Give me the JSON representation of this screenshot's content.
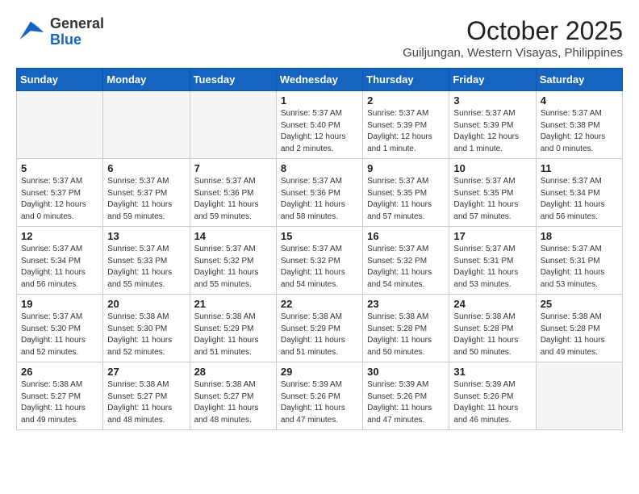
{
  "logo": {
    "general": "General",
    "blue": "Blue"
  },
  "header": {
    "month": "October 2025",
    "location": "Guiljungan, Western Visayas, Philippines"
  },
  "weekdays": [
    "Sunday",
    "Monday",
    "Tuesday",
    "Wednesday",
    "Thursday",
    "Friday",
    "Saturday"
  ],
  "weeks": [
    [
      {
        "day": "",
        "empty": true
      },
      {
        "day": "",
        "empty": true
      },
      {
        "day": "",
        "empty": true
      },
      {
        "day": "1",
        "sunrise": "Sunrise: 5:37 AM",
        "sunset": "Sunset: 5:40 PM",
        "daylight": "Daylight: 12 hours and 2 minutes."
      },
      {
        "day": "2",
        "sunrise": "Sunrise: 5:37 AM",
        "sunset": "Sunset: 5:39 PM",
        "daylight": "Daylight: 12 hours and 1 minute."
      },
      {
        "day": "3",
        "sunrise": "Sunrise: 5:37 AM",
        "sunset": "Sunset: 5:39 PM",
        "daylight": "Daylight: 12 hours and 1 minute."
      },
      {
        "day": "4",
        "sunrise": "Sunrise: 5:37 AM",
        "sunset": "Sunset: 5:38 PM",
        "daylight": "Daylight: 12 hours and 0 minutes."
      }
    ],
    [
      {
        "day": "5",
        "sunrise": "Sunrise: 5:37 AM",
        "sunset": "Sunset: 5:37 PM",
        "daylight": "Daylight: 12 hours and 0 minutes."
      },
      {
        "day": "6",
        "sunrise": "Sunrise: 5:37 AM",
        "sunset": "Sunset: 5:37 PM",
        "daylight": "Daylight: 11 hours and 59 minutes."
      },
      {
        "day": "7",
        "sunrise": "Sunrise: 5:37 AM",
        "sunset": "Sunset: 5:36 PM",
        "daylight": "Daylight: 11 hours and 59 minutes."
      },
      {
        "day": "8",
        "sunrise": "Sunrise: 5:37 AM",
        "sunset": "Sunset: 5:36 PM",
        "daylight": "Daylight: 11 hours and 58 minutes."
      },
      {
        "day": "9",
        "sunrise": "Sunrise: 5:37 AM",
        "sunset": "Sunset: 5:35 PM",
        "daylight": "Daylight: 11 hours and 57 minutes."
      },
      {
        "day": "10",
        "sunrise": "Sunrise: 5:37 AM",
        "sunset": "Sunset: 5:35 PM",
        "daylight": "Daylight: 11 hours and 57 minutes."
      },
      {
        "day": "11",
        "sunrise": "Sunrise: 5:37 AM",
        "sunset": "Sunset: 5:34 PM",
        "daylight": "Daylight: 11 hours and 56 minutes."
      }
    ],
    [
      {
        "day": "12",
        "sunrise": "Sunrise: 5:37 AM",
        "sunset": "Sunset: 5:34 PM",
        "daylight": "Daylight: 11 hours and 56 minutes."
      },
      {
        "day": "13",
        "sunrise": "Sunrise: 5:37 AM",
        "sunset": "Sunset: 5:33 PM",
        "daylight": "Daylight: 11 hours and 55 minutes."
      },
      {
        "day": "14",
        "sunrise": "Sunrise: 5:37 AM",
        "sunset": "Sunset: 5:32 PM",
        "daylight": "Daylight: 11 hours and 55 minutes."
      },
      {
        "day": "15",
        "sunrise": "Sunrise: 5:37 AM",
        "sunset": "Sunset: 5:32 PM",
        "daylight": "Daylight: 11 hours and 54 minutes."
      },
      {
        "day": "16",
        "sunrise": "Sunrise: 5:37 AM",
        "sunset": "Sunset: 5:32 PM",
        "daylight": "Daylight: 11 hours and 54 minutes."
      },
      {
        "day": "17",
        "sunrise": "Sunrise: 5:37 AM",
        "sunset": "Sunset: 5:31 PM",
        "daylight": "Daylight: 11 hours and 53 minutes."
      },
      {
        "day": "18",
        "sunrise": "Sunrise: 5:37 AM",
        "sunset": "Sunset: 5:31 PM",
        "daylight": "Daylight: 11 hours and 53 minutes."
      }
    ],
    [
      {
        "day": "19",
        "sunrise": "Sunrise: 5:37 AM",
        "sunset": "Sunset: 5:30 PM",
        "daylight": "Daylight: 11 hours and 52 minutes."
      },
      {
        "day": "20",
        "sunrise": "Sunrise: 5:38 AM",
        "sunset": "Sunset: 5:30 PM",
        "daylight": "Daylight: 11 hours and 52 minutes."
      },
      {
        "day": "21",
        "sunrise": "Sunrise: 5:38 AM",
        "sunset": "Sunset: 5:29 PM",
        "daylight": "Daylight: 11 hours and 51 minutes."
      },
      {
        "day": "22",
        "sunrise": "Sunrise: 5:38 AM",
        "sunset": "Sunset: 5:29 PM",
        "daylight": "Daylight: 11 hours and 51 minutes."
      },
      {
        "day": "23",
        "sunrise": "Sunrise: 5:38 AM",
        "sunset": "Sunset: 5:28 PM",
        "daylight": "Daylight: 11 hours and 50 minutes."
      },
      {
        "day": "24",
        "sunrise": "Sunrise: 5:38 AM",
        "sunset": "Sunset: 5:28 PM",
        "daylight": "Daylight: 11 hours and 50 minutes."
      },
      {
        "day": "25",
        "sunrise": "Sunrise: 5:38 AM",
        "sunset": "Sunset: 5:28 PM",
        "daylight": "Daylight: 11 hours and 49 minutes."
      }
    ],
    [
      {
        "day": "26",
        "sunrise": "Sunrise: 5:38 AM",
        "sunset": "Sunset: 5:27 PM",
        "daylight": "Daylight: 11 hours and 49 minutes."
      },
      {
        "day": "27",
        "sunrise": "Sunrise: 5:38 AM",
        "sunset": "Sunset: 5:27 PM",
        "daylight": "Daylight: 11 hours and 48 minutes."
      },
      {
        "day": "28",
        "sunrise": "Sunrise: 5:38 AM",
        "sunset": "Sunset: 5:27 PM",
        "daylight": "Daylight: 11 hours and 48 minutes."
      },
      {
        "day": "29",
        "sunrise": "Sunrise: 5:39 AM",
        "sunset": "Sunset: 5:26 PM",
        "daylight": "Daylight: 11 hours and 47 minutes."
      },
      {
        "day": "30",
        "sunrise": "Sunrise: 5:39 AM",
        "sunset": "Sunset: 5:26 PM",
        "daylight": "Daylight: 11 hours and 47 minutes."
      },
      {
        "day": "31",
        "sunrise": "Sunrise: 5:39 AM",
        "sunset": "Sunset: 5:26 PM",
        "daylight": "Daylight: 11 hours and 46 minutes."
      },
      {
        "day": "",
        "empty": true
      }
    ]
  ]
}
